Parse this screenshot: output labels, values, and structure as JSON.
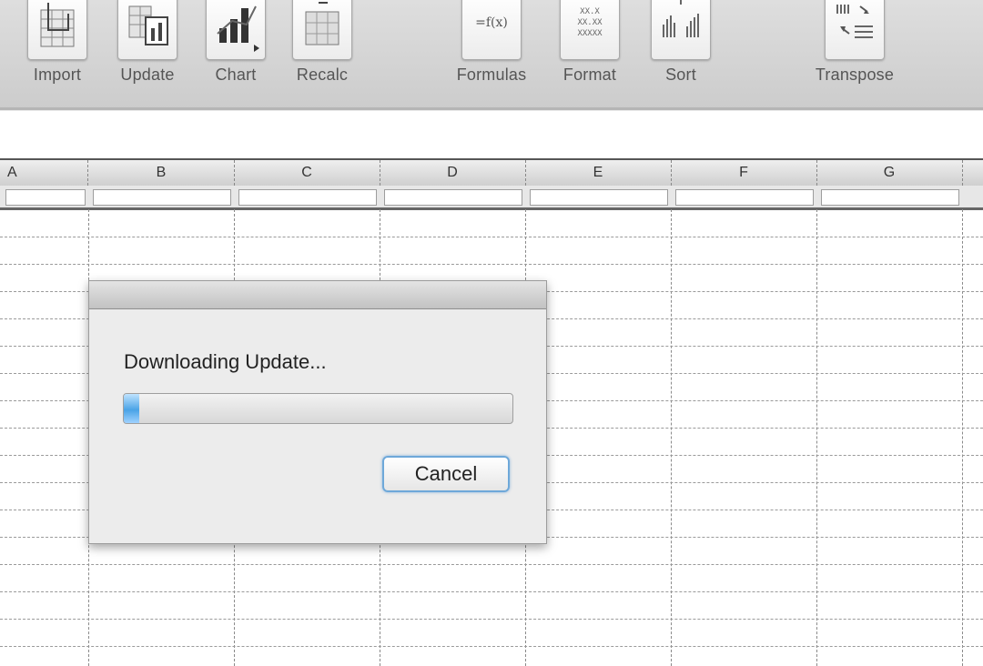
{
  "toolbar": {
    "buttons": [
      {
        "name": "import",
        "label": "Import",
        "icon": "import-icon"
      },
      {
        "name": "update",
        "label": "Update",
        "icon": "update-icon"
      },
      {
        "name": "chart",
        "label": "Chart",
        "icon": "chart-icon"
      },
      {
        "name": "recalc",
        "label": "Recalc",
        "icon": "recalc-icon"
      },
      {
        "name": "formulas",
        "label": "Formulas",
        "icon": "formulas-icon",
        "icon_text": "=f(x)"
      },
      {
        "name": "format",
        "label": "Format",
        "icon": "format-icon",
        "icon_text": "XX.X XX.XX XXXXX"
      },
      {
        "name": "sort",
        "label": "Sort",
        "icon": "sort-icon"
      },
      {
        "name": "transpose",
        "label": "Transpose",
        "icon": "transpose-icon"
      }
    ]
  },
  "grid": {
    "columns": [
      "A",
      "B",
      "C",
      "D",
      "E",
      "F",
      "G"
    ]
  },
  "dialog": {
    "message": "Downloading Update...",
    "progress_fraction": 0.04,
    "cancel_label": "Cancel"
  }
}
